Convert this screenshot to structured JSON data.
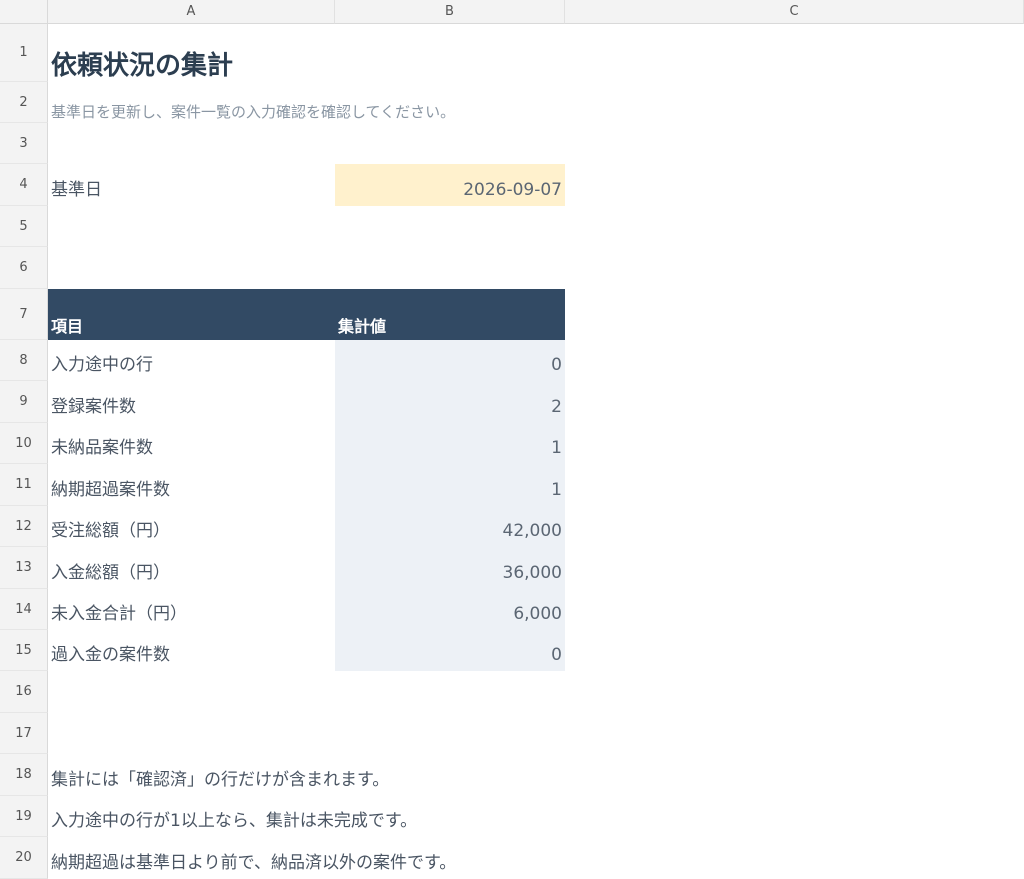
{
  "columns": [
    "A",
    "B",
    "C"
  ],
  "rows": [
    "1",
    "2",
    "3",
    "4",
    "5",
    "6",
    "7",
    "8",
    "9",
    "10",
    "11",
    "12",
    "13",
    "14",
    "15",
    "16",
    "17",
    "18",
    "19",
    "20"
  ],
  "title": "依頼状況の集計",
  "subtitle": "基準日を更新し、案件一覧の入力確認を確認してください。",
  "base_date": {
    "label": "基準日",
    "value": "2026-09-07"
  },
  "table": {
    "header": {
      "item": "項目",
      "value": "集計値"
    },
    "rows": [
      {
        "label": "入力途中の行",
        "value": "0"
      },
      {
        "label": "登録案件数",
        "value": "2"
      },
      {
        "label": "未納品案件数",
        "value": "1"
      },
      {
        "label": "納期超過案件数",
        "value": "1"
      },
      {
        "label": "受注総額（円）",
        "value": "42,000"
      },
      {
        "label": "入金総額（円）",
        "value": "36,000"
      },
      {
        "label": "未入金合計（円）",
        "value": "6,000"
      },
      {
        "label": "過入金の案件数",
        "value": "0"
      }
    ]
  },
  "notes": [
    "集計には「確認済」の行だけが含まれます。",
    "入力途中の行が1以上なら、集計は未完成です。",
    "納期超過は基準日より前で、納品済以外の案件です。"
  ],
  "colors": {
    "header_bg": "#324a64",
    "value_bg": "#edf1f6",
    "date_bg": "#fff1cd"
  }
}
